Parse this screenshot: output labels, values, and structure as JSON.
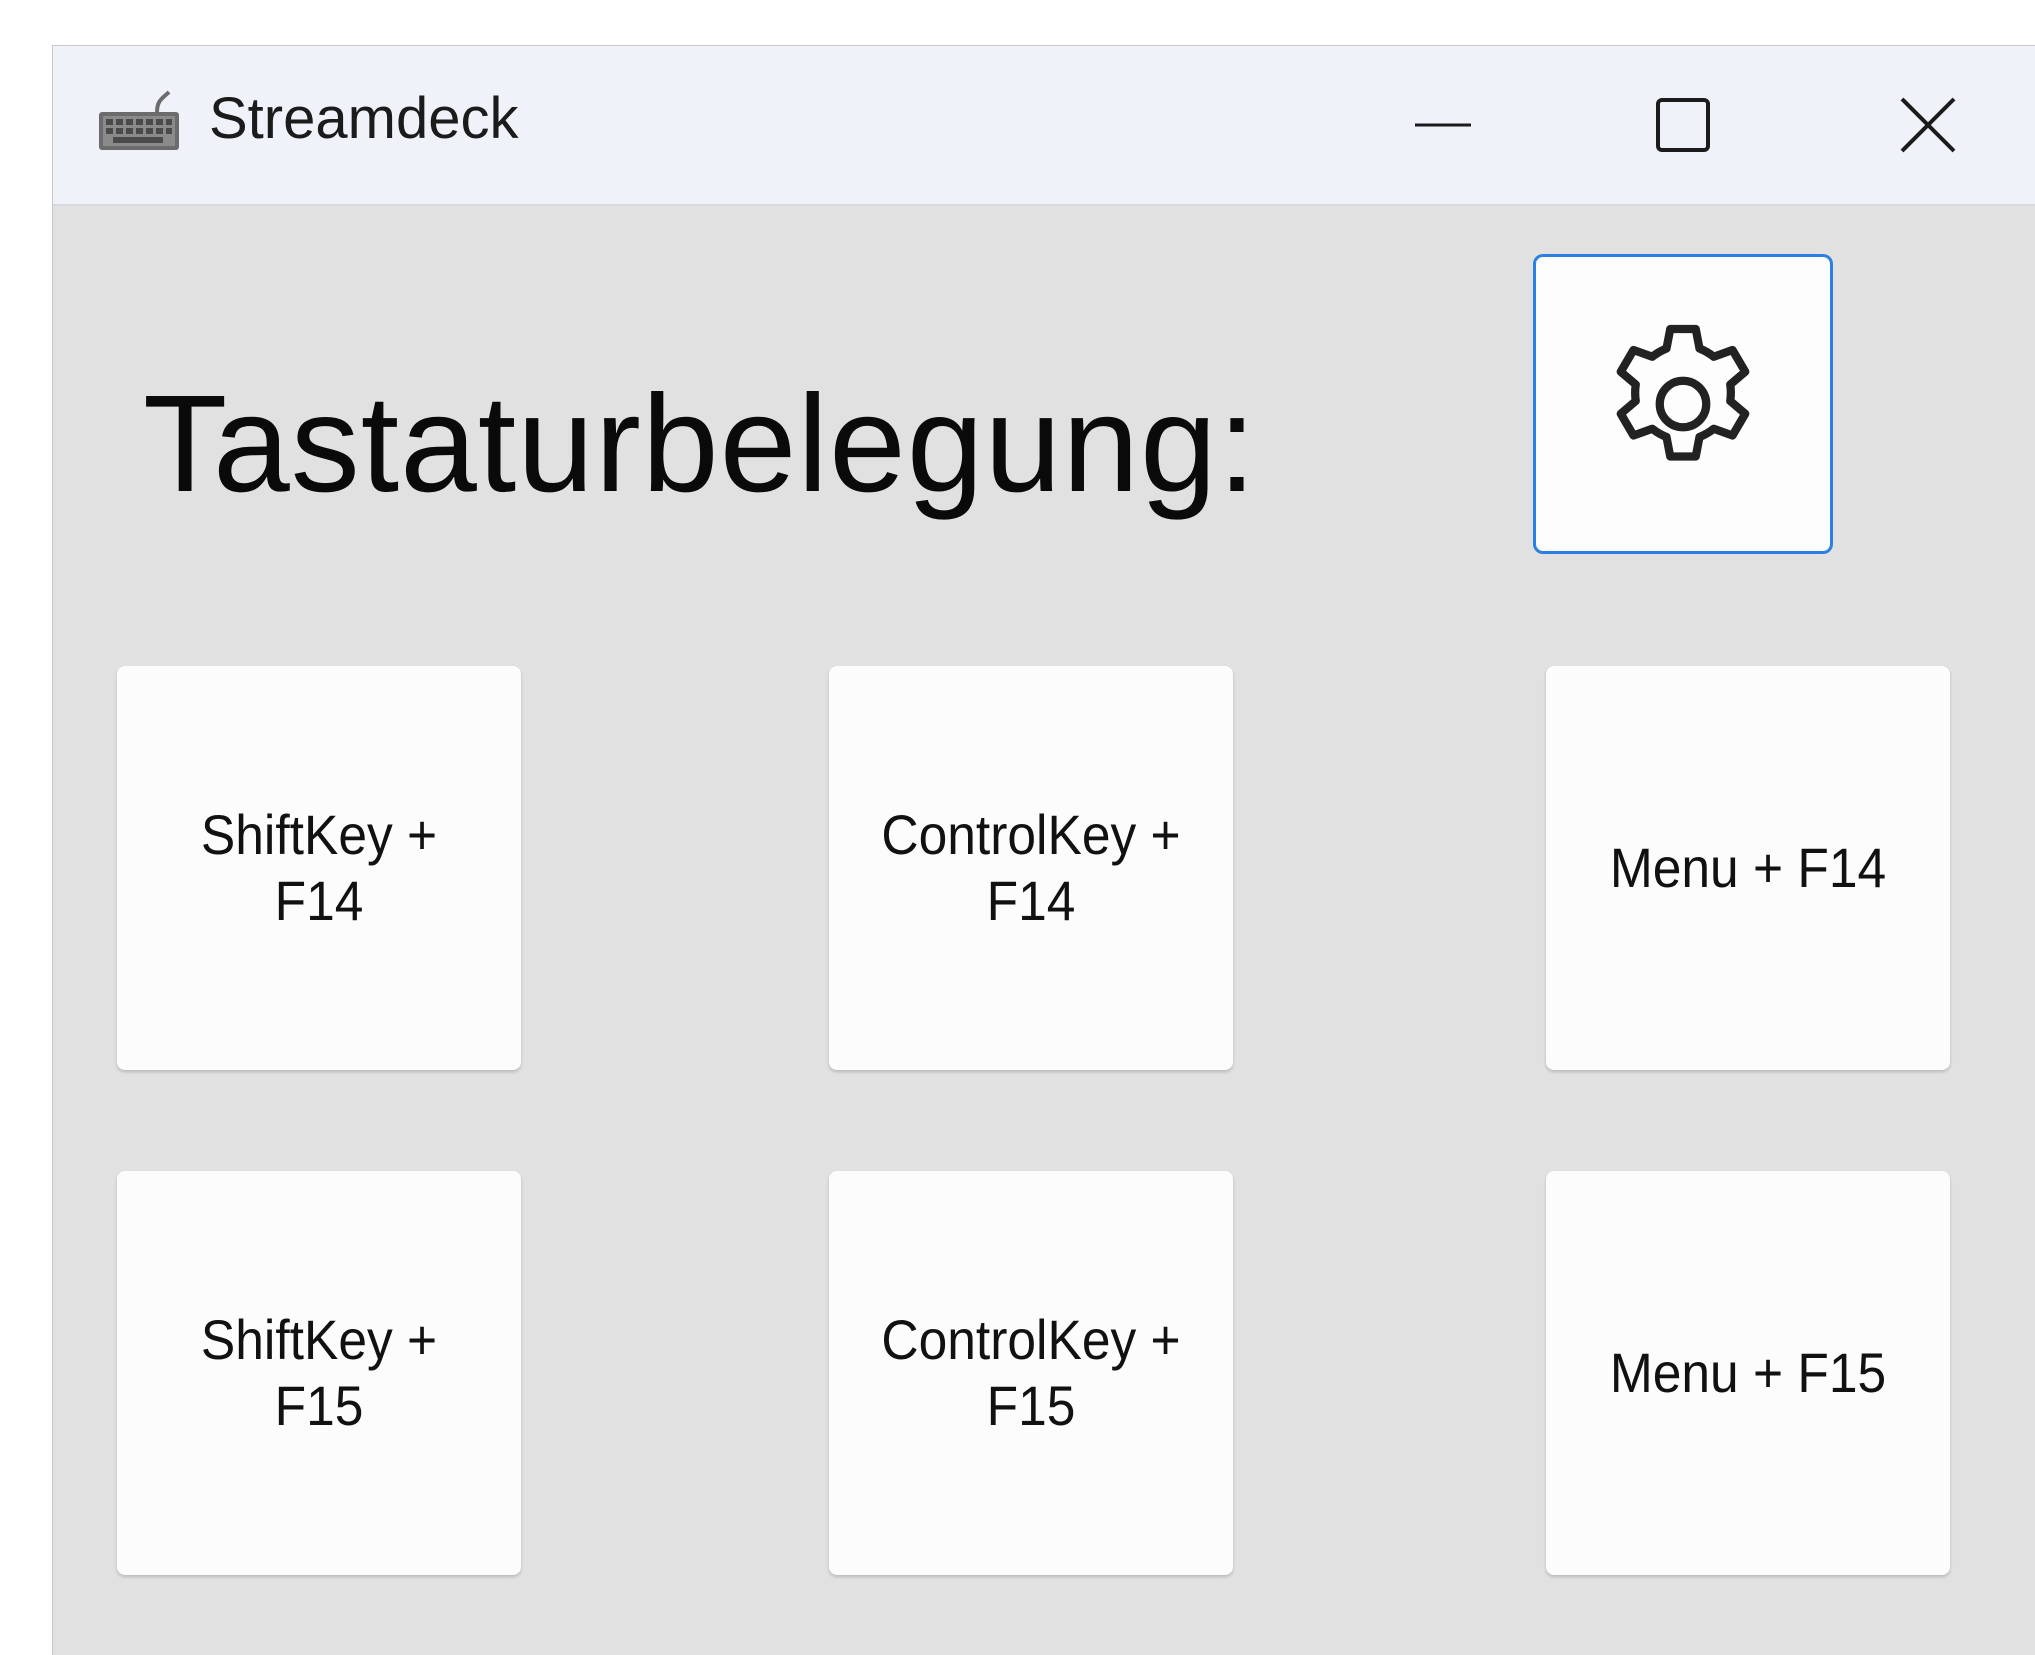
{
  "window": {
    "title": "Streamdeck",
    "app_icon": "keyboard-icon",
    "controls": {
      "minimize_icon": "minimize-icon",
      "maximize_icon": "maximize-icon",
      "close_icon": "close-icon"
    }
  },
  "main": {
    "heading": "Tastaturbelegung:",
    "settings_icon": "gear-icon",
    "accent_color": "#2c7fe3",
    "keys": [
      {
        "label": "ShiftKey + F14"
      },
      {
        "label": "ControlKey + F14"
      },
      {
        "label": "Menu + F14"
      },
      {
        "label": "ShiftKey + F15"
      },
      {
        "label": "ControlKey + F15"
      },
      {
        "label": "Menu + F15"
      }
    ]
  }
}
